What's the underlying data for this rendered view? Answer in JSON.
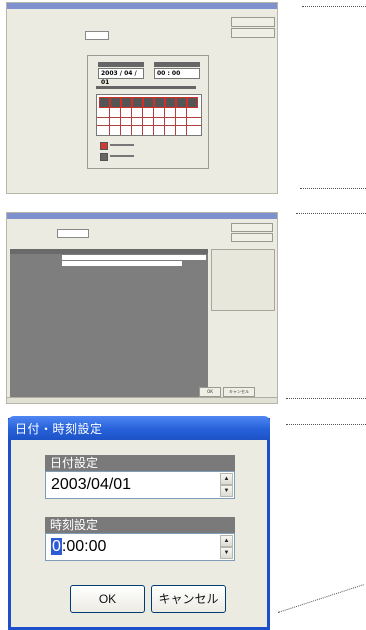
{
  "dialog": {
    "title": "日付・時刻設定",
    "date_section_label": "日付設定",
    "date_value": "2003/04/01",
    "time_section_label": "時刻設定",
    "time_value_selected": "0",
    "time_value_rest": ":00:00",
    "ok_label": "OK",
    "cancel_label": "キャンセル",
    "spin_up": "▲",
    "spin_down": "▼"
  },
  "top_screen": {
    "date_value": "2003 / 04 / 01",
    "time_value": "00 : 00"
  },
  "middle_screen": {
    "ok_label": "OK",
    "cancel_label": "キャンセル"
  },
  "colors": {
    "titlebar": "#2661da",
    "dialog_bg": "#ecebe2",
    "section_label_bg": "#7a7a7a",
    "selection": "#2d5bd6"
  }
}
